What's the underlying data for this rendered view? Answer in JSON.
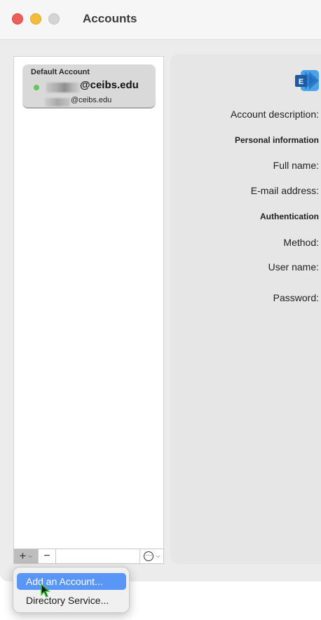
{
  "window": {
    "title": "Accounts"
  },
  "sidebar": {
    "account": {
      "header": "Default Account",
      "email_main": "@ceibs.edu",
      "email_sub": "@ceibs.edu",
      "status_color": "#5fc85b"
    }
  },
  "toolbar": {
    "add_symbol": "+",
    "remove_symbol": "−",
    "more_symbol": "···"
  },
  "detail": {
    "icon": "exchange-icon",
    "labels": {
      "account_description": "Account description:",
      "personal_information": "Personal information",
      "full_name": "Full name:",
      "email_address": "E-mail address:",
      "authentication": "Authentication",
      "method": "Method:",
      "user_name": "User name:",
      "password": "Password:"
    }
  },
  "menu": {
    "items": [
      {
        "label": "Add an Account..."
      },
      {
        "label": "Directory Service..."
      }
    ],
    "selected_color": "#5a96f5"
  }
}
